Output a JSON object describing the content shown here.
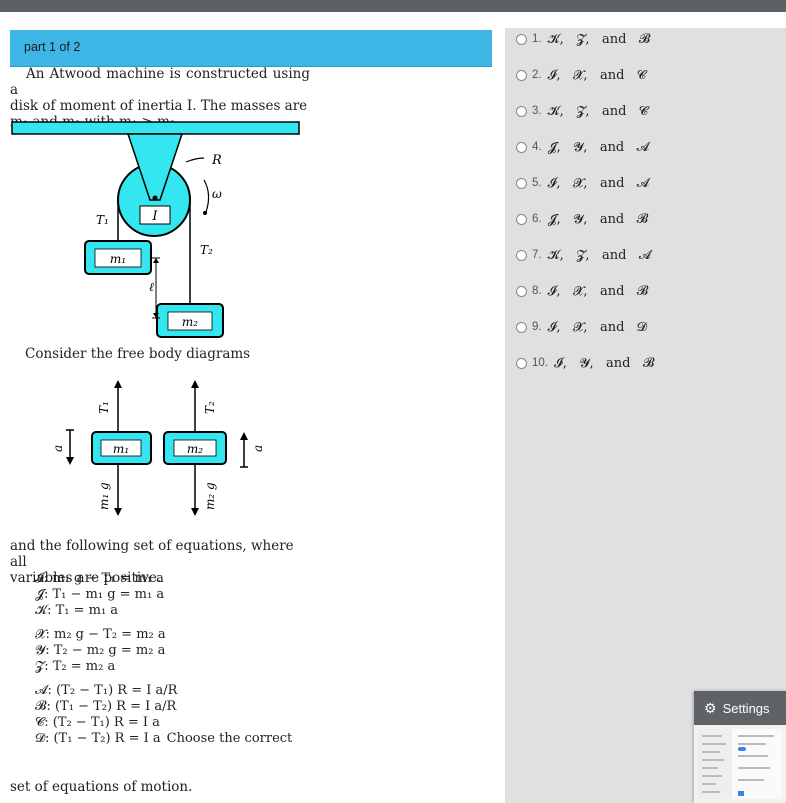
{
  "header": {
    "part_label": "part 1 of 2"
  },
  "problem": {
    "line1": "An Atwood machine is constructed using a",
    "line2": "disk of moment of inertia I. The masses are",
    "line3": "m₁ and m₂ with m₁ > m₂."
  },
  "diagram": {
    "R": "R",
    "omega": "ω",
    "I": "I",
    "T1": "T₁",
    "T2": "T₂",
    "m1": "m₁",
    "m2": "m₂",
    "ell": "ℓ"
  },
  "consider_text": "Consider the free body diagrams",
  "fbd": {
    "T1": "T₁",
    "T2": "T₂",
    "m1": "m₁",
    "m2": "m₂",
    "m1g": "m₁ g",
    "m2g": "m₂ g",
    "a_left": "a",
    "a_right": "a"
  },
  "equations_intro": {
    "line1": "and the following set of equations, where all",
    "line2": "variables are positive."
  },
  "equations": {
    "I": "𝓘: m₁ g − T₁ = m₁ a",
    "J": "𝓙: T₁ − m₁ g = m₁ a",
    "K": "𝓚: T₁ = m₁ a",
    "X": "𝓧: m₂ g − T₂ = m₂ a",
    "Y": "𝓨: T₂ − m₂ g = m₂ a",
    "Z": "𝓩: T₂ = m₂ a",
    "A": "𝓐: (T₂ − T₁) R = I a/R",
    "B": "𝓑: (T₁ − T₂) R = I a/R",
    "C": "𝓒: (T₂ − T₁) R = I a",
    "D": "𝓓: (T₁ − T₂) R = I a"
  },
  "final": {
    "tail": "Choose the correct",
    "line2": "set of equations of motion."
  },
  "options": [
    {
      "num": "1.",
      "text": "𝓚,   𝓩,   and   𝓑"
    },
    {
      "num": "2.",
      "text": "𝓘,   𝓧,   and   𝓒"
    },
    {
      "num": "3.",
      "text": "𝓚,   𝓩,   and   𝓒"
    },
    {
      "num": "4.",
      "text": "𝓙,   𝓨,   and   𝓐"
    },
    {
      "num": "5.",
      "text": "𝓘,   𝓧,   and   𝓐"
    },
    {
      "num": "6.",
      "text": "𝓙,   𝓨,   and   𝓑"
    },
    {
      "num": "7.",
      "text": "𝓚,   𝓩,   and   𝓐"
    },
    {
      "num": "8.",
      "text": "𝓘,   𝓧,   and   𝓑"
    },
    {
      "num": "9.",
      "text": "𝓘,   𝓧,   and   𝓓"
    },
    {
      "num": "10.",
      "text": "𝓘,   𝓨,   and   𝓑"
    }
  ],
  "settings": {
    "label": "Settings",
    "icon": "gear-icon"
  },
  "colors": {
    "header": "#3db6e6",
    "cyan": "#33e6f0",
    "panel": "#e0e0e0"
  }
}
